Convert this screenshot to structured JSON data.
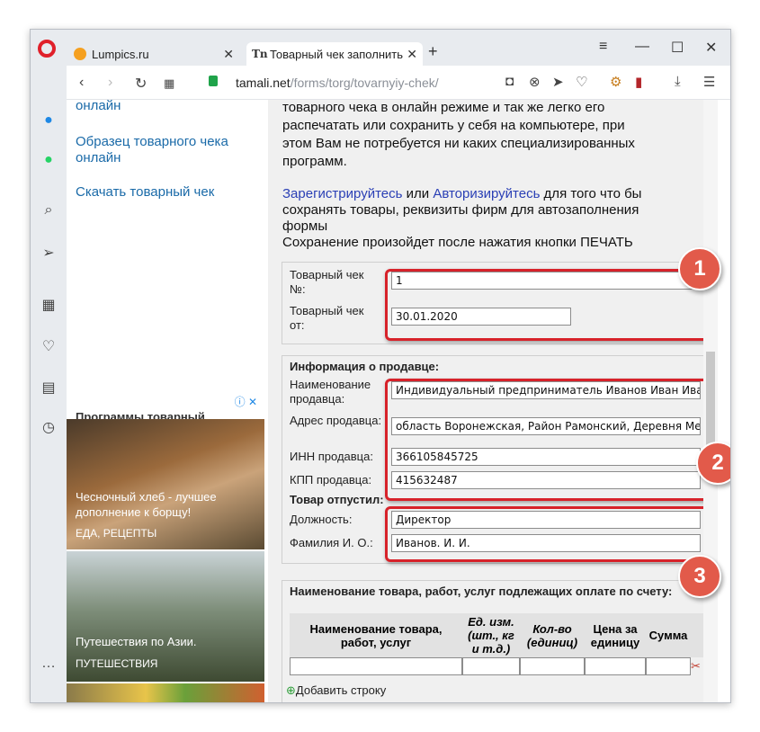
{
  "tabs": [
    {
      "title": "Lumpics.ru"
    },
    {
      "title": "Товарный чек заполнить"
    }
  ],
  "address": {
    "domain": "tamali.net",
    "path": "/forms/torg/tovarnyiy-chek/"
  },
  "left_links": {
    "partial": "онлайн",
    "sample": "Образец товарного чека онлайн",
    "download": "Скачать товарный чек"
  },
  "ad": {
    "header": "Программы товарный",
    "items": [
      {
        "caption": "Чесночный хлеб - лучшее дополнение к борщу!",
        "tag": "ЕДА, РЕЦЕПТЫ"
      },
      {
        "caption": "Путешествия по Азии.",
        "tag": "ПУТЕШЕСТВИЯ"
      }
    ]
  },
  "intro": {
    "line1": "товарного чека в онлайн режиме и так же легко его",
    "line2": "распечатать или сохранить у себя на компьютере, при",
    "line3": "этом Вам не потребуется ни каких специализированных",
    "line4": "программ.",
    "register": "Зарегистрируйтесь",
    "or": " или ",
    "login": "Авторизируйтесь",
    "rest1": " для того что бы",
    "rest2": "сохранять товары, реквизиты фирм для автозаполнения",
    "rest3": "формы",
    "save_note": "Сохранение произойдет после нажатия кнопки ПЕЧАТЬ"
  },
  "receipt": {
    "num_label": "Товарный чек №:",
    "num_value": "1",
    "date_label": "Товарный чек от:",
    "date_value": "30.01.2020"
  },
  "seller": {
    "section_title": "Информация о продавце:",
    "name_label": "Наименование продавца:",
    "name_value": "Индивидуальный предприниматель Иванов Иван Иван",
    "address_label": "Адрес продавца:",
    "address_value": "область Воронежская, Район Рамонский, Деревня Мед",
    "inn_label": "ИНН продавца:",
    "inn_value": "366105845725",
    "kpp_label": "КПП продавца:",
    "kpp_value": "415632487",
    "released_title": "Товар отпустил:",
    "position_label": "Должность:",
    "position_value": "Директор",
    "fio_label": "Фамилия И. О.:",
    "fio_value": "Иванов. И. И."
  },
  "goods": {
    "title": "Наименование товара, работ, услуг подлежащих оплате по счету:",
    "columns": [
      "Наименование товара, работ, услуг",
      "Ед. изм. (шт., кг и т.д.)",
      "Кол-во (единиц)",
      "Цена за единицу",
      "Сумма"
    ],
    "add_row": "Добавить строку"
  },
  "badges": [
    "1",
    "2",
    "3"
  ],
  "colors": {
    "highlight": "#d7222a",
    "badge": "#e25a4a",
    "link": "#1a6aa8"
  }
}
